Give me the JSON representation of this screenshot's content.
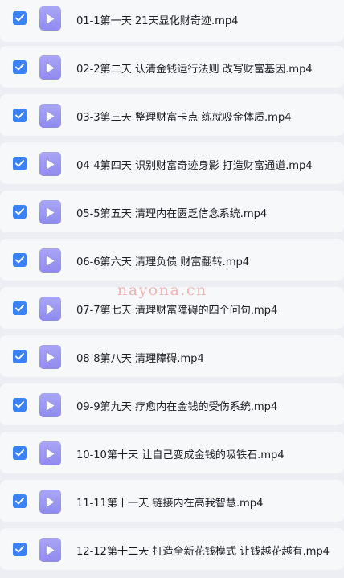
{
  "files": [
    {
      "name": "01-1第一天 21天显化财奇迹.mp4",
      "checked": true
    },
    {
      "name": "02-2第二天 认清金钱运行法则 改写财富基因.mp4",
      "checked": true
    },
    {
      "name": "03-3第三天 整理财富卡点 练就吸金体质.mp4",
      "checked": true
    },
    {
      "name": "04-4第四天 识别财富奇迹身影 打造财富通道.mp4",
      "checked": true
    },
    {
      "name": "05-5第五天 清理内在匮乏信念系统.mp4",
      "checked": true
    },
    {
      "name": "06-6第六天 清理负债 财富翻转.mp4",
      "checked": true
    },
    {
      "name": "07-7第七天 清理财富障碍的四个问句.mp4",
      "checked": true
    },
    {
      "name": "08-8第八天 清理障碍.mp4",
      "checked": true
    },
    {
      "name": "09-9第九天 疗愈内在金钱的受伤系统.mp4",
      "checked": true
    },
    {
      "name": "10-10第十天 让自己变成金钱的吸铁石.mp4",
      "checked": true
    },
    {
      "name": "11-11第十一天 链接内在高我智慧.mp4",
      "checked": true
    },
    {
      "name": "12-12第十二天 打造全新花钱模式 让钱越花越有.mp4",
      "checked": true
    }
  ],
  "watermark": "nayona.cn",
  "colors": {
    "checkbox": "#3b82f6",
    "file_icon": "#9b97f2",
    "row_background": "#f7f8fa",
    "page_background": "#eceef4",
    "watermark": "#f2b3b3"
  },
  "icons": {
    "checkbox": "checkmark-icon",
    "file": "video-play-icon"
  }
}
